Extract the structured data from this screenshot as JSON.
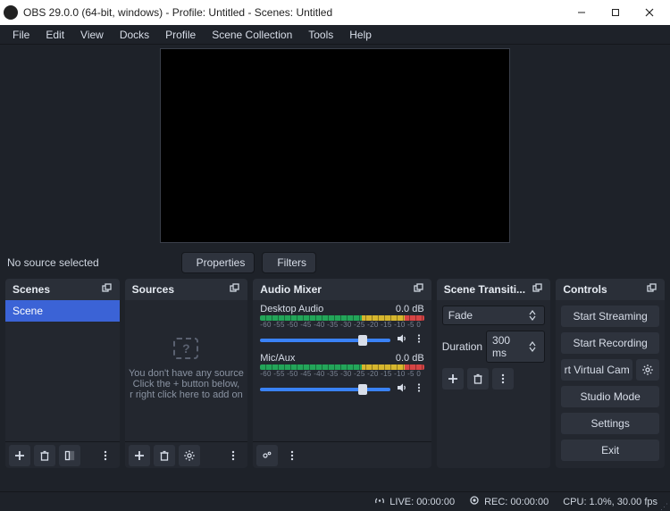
{
  "window": {
    "title": "OBS 29.0.0 (64-bit, windows) - Profile: Untitled - Scenes: Untitled"
  },
  "menu": {
    "items": [
      "File",
      "Edit",
      "View",
      "Docks",
      "Profile",
      "Scene Collection",
      "Tools",
      "Help"
    ]
  },
  "props": {
    "nosource": "No source selected",
    "properties": "Properties",
    "filters": "Filters"
  },
  "panels": {
    "scenes": {
      "title": "Scenes",
      "item": "Scene"
    },
    "sources": {
      "title": "Sources",
      "empty1": "You don't have any source",
      "empty2": "Click the + button below,",
      "empty3": "r right click here to add on"
    },
    "mixer": {
      "title": "Audio Mixer",
      "scale": "-60 -55 -50 -45 -40 -35 -30 -25 -20 -15 -10 -5 0",
      "tracks": [
        {
          "name": "Desktop Audio",
          "db": "0.0 dB"
        },
        {
          "name": "Mic/Aux",
          "db": "0.0 dB"
        }
      ]
    },
    "transitions": {
      "title": "Scene Transiti...",
      "selected": "Fade",
      "duration_label": "Duration",
      "duration_val": "300 ms"
    },
    "controls": {
      "title": "Controls",
      "start_streaming": "Start Streaming",
      "start_recording": "Start Recording",
      "virtual_cam": "rt Virtual Cam",
      "studio_mode": "Studio Mode",
      "settings": "Settings",
      "exit": "Exit"
    }
  },
  "status": {
    "live": "LIVE: 00:00:00",
    "rec": "REC: 00:00:00",
    "cpu": "CPU: 1.0%, 30.00 fps"
  }
}
